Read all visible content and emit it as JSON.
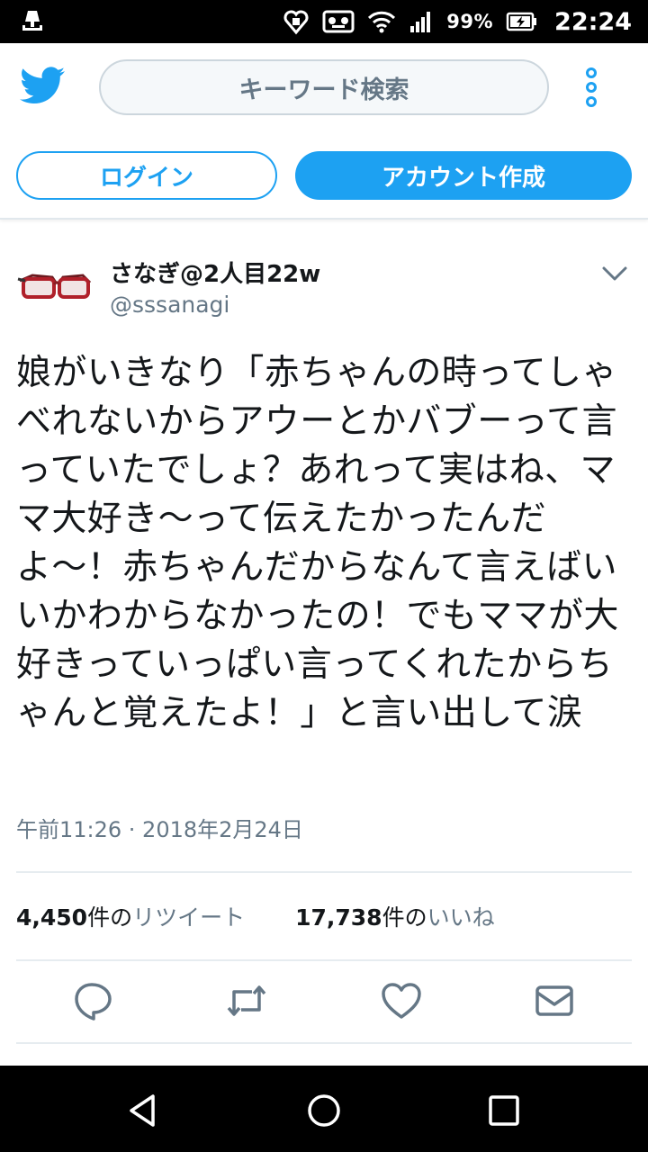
{
  "status_bar": {
    "battery_percent": "99%",
    "time": "22:24",
    "icons": [
      "notification-icon",
      "vibrate-icon",
      "voicemail-icon",
      "wifi-icon",
      "signal-icon",
      "battery-charging-icon"
    ]
  },
  "header": {
    "logo_icon": "twitter-bird-icon",
    "search_placeholder": "キーワード検索",
    "menu_icon": "more-vertical-icon",
    "login_label": "ログイン",
    "signup_label": "アカウント作成"
  },
  "tweet": {
    "display_name": "さなぎ@2人目22w",
    "handle": "@sssanagi",
    "text": "娘がいきなり「赤ちゃんの時ってしゃべれないからアウーとかバブーって言っていたでしょ？あれって実はね、ママ大好き〜って伝えたかったんだよ〜！赤ちゃんだからなんて言えばいいかわからなかったの！でもママが大好きっていっぱい言ってくれたからちゃんと覚えたよ！」と言い出して涙",
    "timestamp": "午前11:26 · 2018年2月24日",
    "retweets": {
      "count": "4,450",
      "unit": "件の",
      "label": "リツイート"
    },
    "likes": {
      "count": "17,738",
      "unit": "件の",
      "label": "いいね"
    },
    "actions": [
      "reply-icon",
      "retweet-icon",
      "like-icon",
      "direct-message-icon"
    ]
  },
  "nav_bar": {
    "buttons": [
      "back-icon",
      "home-icon",
      "recents-icon"
    ]
  },
  "colors": {
    "accent": "#1da1f2",
    "secondary_text": "#657786",
    "divider": "#e6ecf0"
  }
}
